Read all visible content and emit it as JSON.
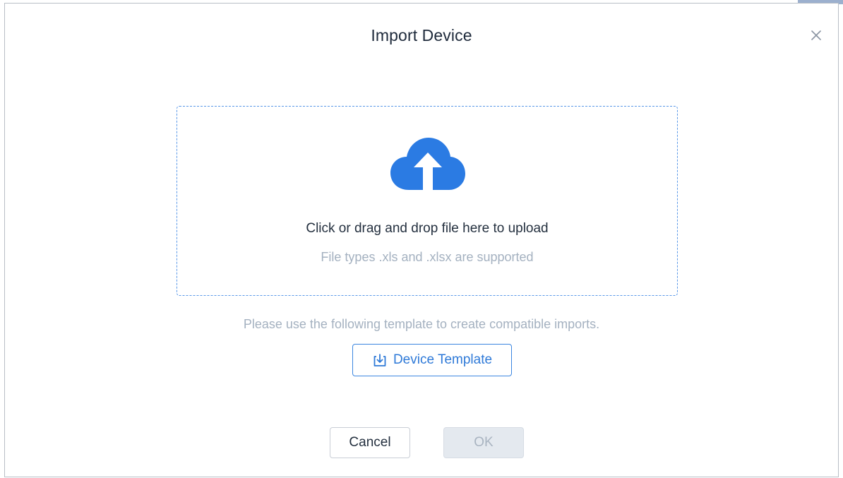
{
  "dialog": {
    "title": "Import Device",
    "close_icon": "close-icon"
  },
  "dropzone": {
    "icon": "cloud-upload-icon",
    "main_text": "Click or drag and drop file here to upload",
    "sub_text": "File types .xls and .xlsx are supported"
  },
  "template": {
    "hint": "Please use the following template to create compatible imports.",
    "button_label": "Device Template",
    "button_icon": "download-icon"
  },
  "footer": {
    "cancel_label": "Cancel",
    "ok_label": "OK",
    "ok_disabled": true
  },
  "colors": {
    "accent": "#2f7ad8",
    "upload_icon": "#2b7be3",
    "title_text": "#1e2a3b",
    "muted_text": "#a4b1c0",
    "dropzone_border": "#5a98e8",
    "disabled_bg": "#e4e9ef"
  }
}
